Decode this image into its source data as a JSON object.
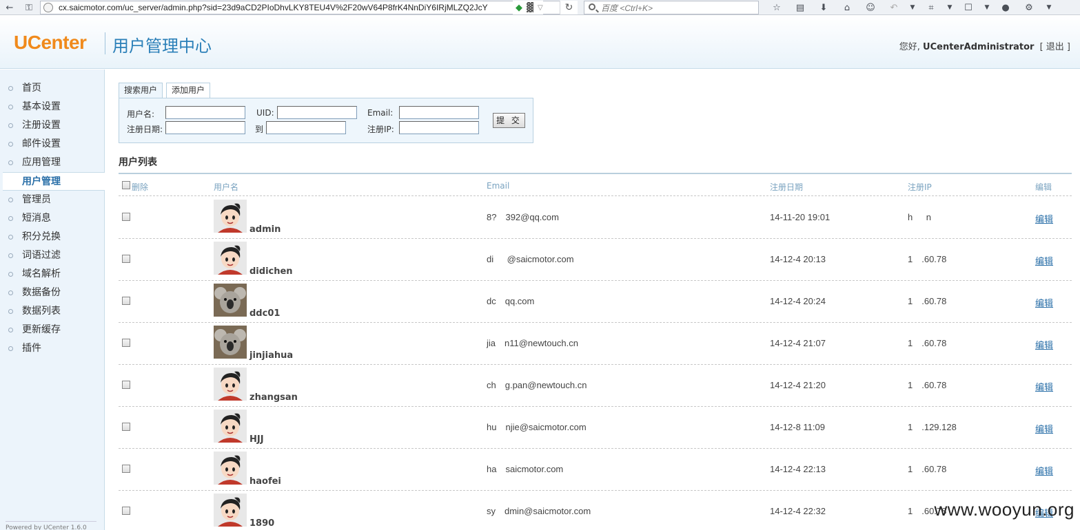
{
  "browser": {
    "url": "cx.saicmotor.com/uc_server/admin.php?sid=23d9aCD2PIoDhvLKY8TEU4V%2F20wV64P8frK4NnDiY6IRjMLZQ2JcY",
    "search_placeholder": "百度 <Ctrl+K>"
  },
  "header": {
    "logo": "UCenter",
    "title": "用户管理中心",
    "greeting": "您好,",
    "admin_name": "UCenterAdministrator",
    "logout": "[ 退出 ]"
  },
  "sidebar": {
    "items": [
      {
        "label": "首页",
        "active": false
      },
      {
        "label": "基本设置",
        "active": false
      },
      {
        "label": "注册设置",
        "active": false
      },
      {
        "label": "邮件设置",
        "active": false
      },
      {
        "label": "应用管理",
        "active": false
      },
      {
        "label": "用户管理",
        "active": true
      },
      {
        "label": "管理员",
        "active": false
      },
      {
        "label": "短消息",
        "active": false
      },
      {
        "label": "积分兑换",
        "active": false
      },
      {
        "label": "词语过滤",
        "active": false
      },
      {
        "label": "域名解析",
        "active": false
      },
      {
        "label": "数据备份",
        "active": false
      },
      {
        "label": "数据列表",
        "active": false
      },
      {
        "label": "更新缓存",
        "active": false
      },
      {
        "label": "插件",
        "active": false
      }
    ],
    "powered": "Powered by UCenter 1.6.0"
  },
  "search": {
    "tabs": [
      "搜索用户",
      "添加用户"
    ],
    "username_label": "用户名:",
    "uid_label": "UID:",
    "email_label": "Email:",
    "regdate_label": "注册日期:",
    "to_label": "到",
    "regip_label": "注册IP:",
    "submit": "提 交"
  },
  "list": {
    "title": "用户列表",
    "columns": {
      "delete": "删除",
      "username": "用户名",
      "email": "Email",
      "regdate": "注册日期",
      "regip": "注册IP",
      "edit": "编辑"
    },
    "rows": [
      {
        "username": "admin",
        "email": "8?  392@qq.com",
        "regdate": "14-11-20 19:01",
        "regip": "h   n",
        "avatar": "cartoon-avatar",
        "edit": "编辑"
      },
      {
        "username": "didichen",
        "email": "di   @saicmotor.com",
        "regdate": "14-12-4 20:13",
        "regip": "1  .60.78",
        "avatar": "cartoon-avatar",
        "edit": "编辑"
      },
      {
        "username": "ddc01",
        "email": "dc  qq.com",
        "regdate": "14-12-4 20:24",
        "regip": "1  .60.78",
        "avatar": "koala-avatar",
        "edit": "编辑"
      },
      {
        "username": "jinjiahua",
        "email": "jia  n11@newtouch.cn",
        "regdate": "14-12-4 21:07",
        "regip": "1  .60.78",
        "avatar": "koala-avatar",
        "edit": "编辑"
      },
      {
        "username": "zhangsan",
        "email": "ch  g.pan@newtouch.cn",
        "regdate": "14-12-4 21:20",
        "regip": "1  .60.78",
        "avatar": "cartoon-avatar",
        "edit": "编辑"
      },
      {
        "username": "HJJ",
        "email": "hu  njie@saicmotor.com",
        "regdate": "14-12-8 11:09",
        "regip": "1  .129.128",
        "avatar": "cartoon-avatar",
        "edit": "编辑"
      },
      {
        "username": "haofei",
        "email": "ha  saicmotor.com",
        "regdate": "14-12-4 22:13",
        "regip": "1  .60.78",
        "avatar": "cartoon-avatar",
        "edit": "编辑"
      },
      {
        "username": "1890",
        "email": "sy  dmin@saicmotor.com",
        "regdate": "14-12-4 22:32",
        "regip": "1  .60.78",
        "avatar": "cartoon-avatar",
        "edit": "编辑"
      }
    ]
  },
  "watermark": "www.wooyun.org",
  "colors": {
    "logo": "#f08a1c",
    "title": "#2a7fb8",
    "link": "#2a6fa8",
    "sidebar_bg": "#ecf4fb"
  }
}
